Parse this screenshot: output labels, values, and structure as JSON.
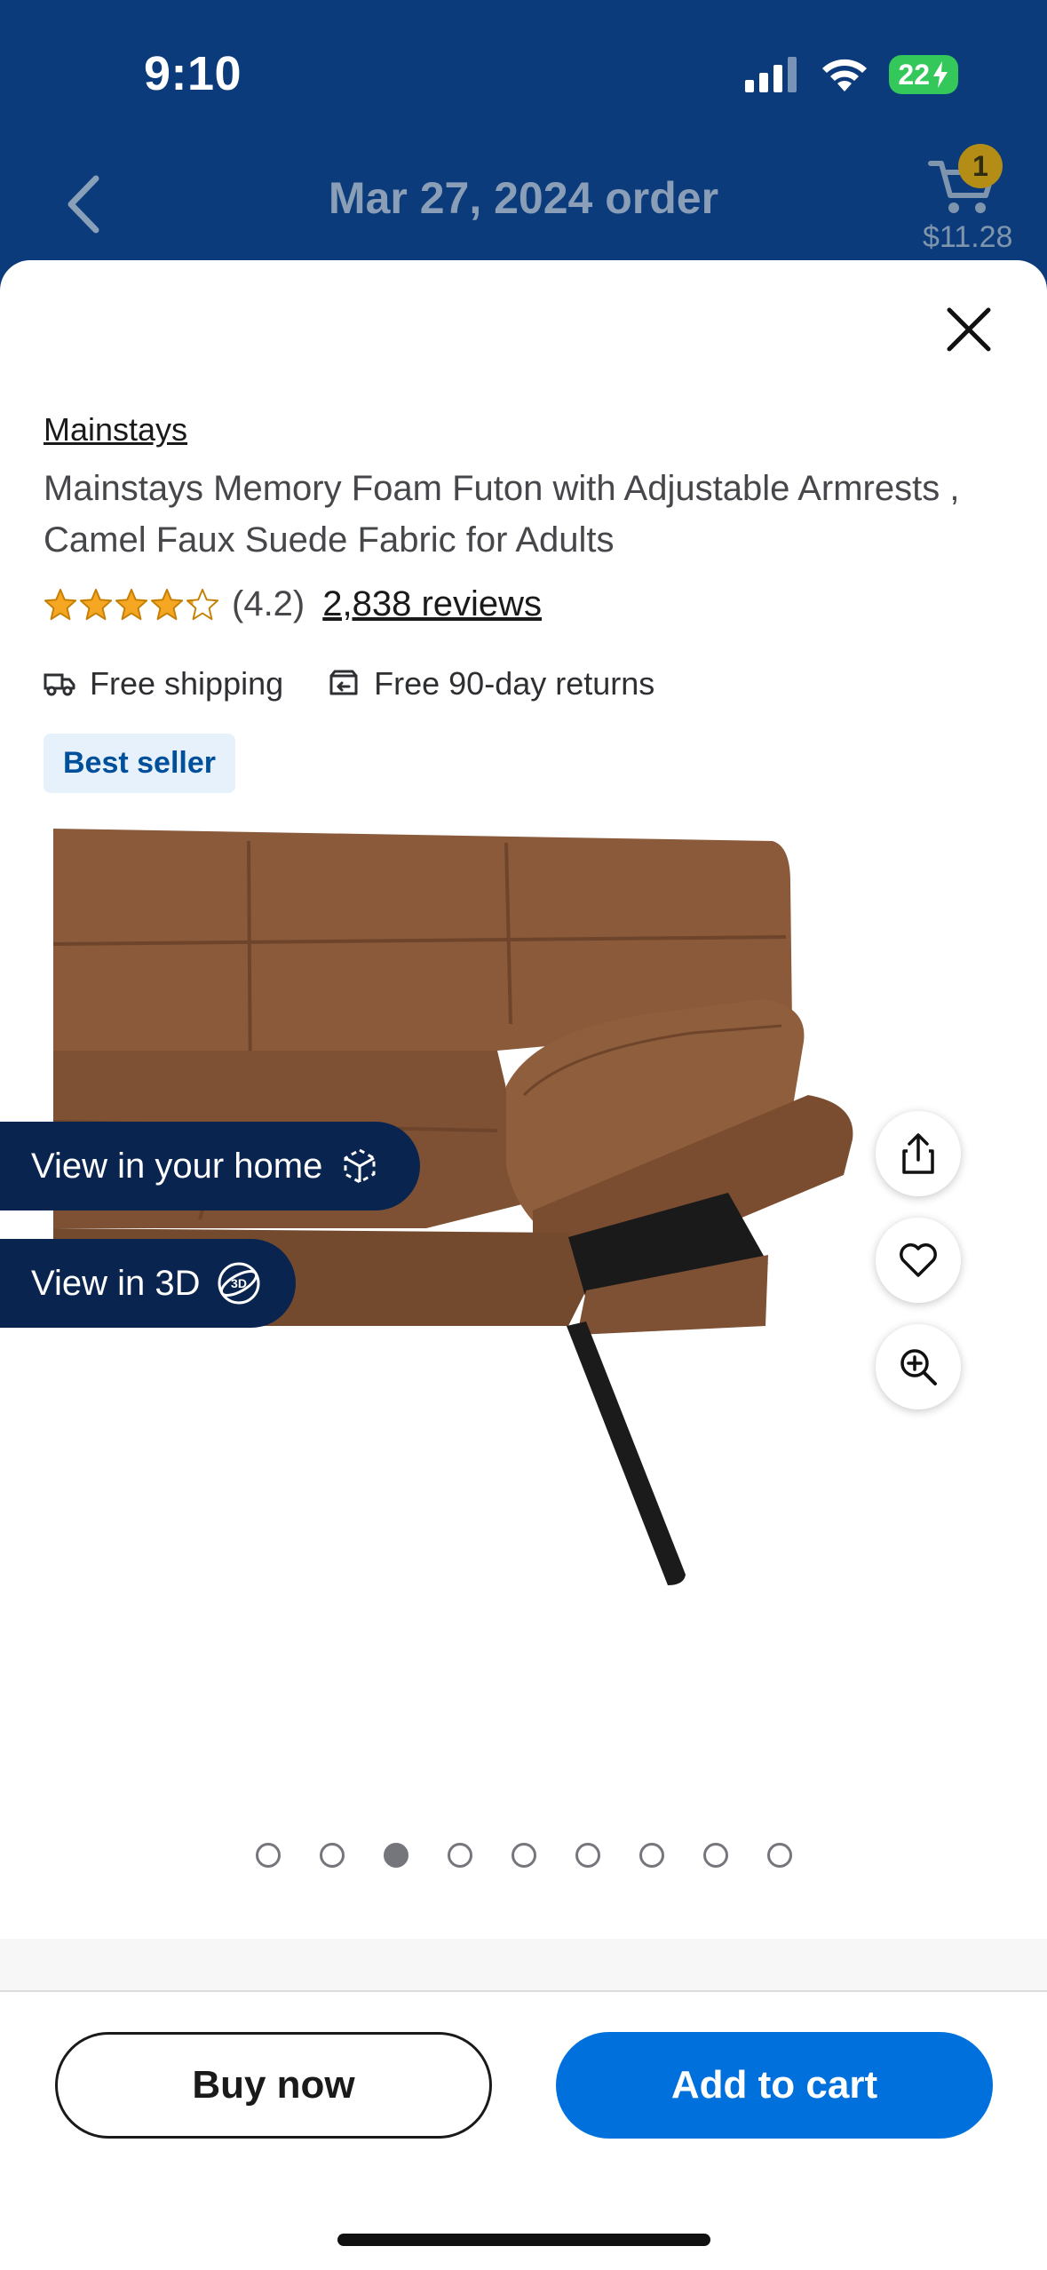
{
  "status_bar": {
    "time": "9:10",
    "battery": "22"
  },
  "nav": {
    "title": "Mar 27, 2024 order",
    "cart_count": "1",
    "cart_amount": "$11.28"
  },
  "product": {
    "brand": "Mainstays",
    "title": "Mainstays Memory Foam Futon with Adjustable Armrests , Camel Faux Suede Fabric for Adults",
    "rating": 4.2,
    "rating_text": "(4.2)",
    "reviews": "2,838 reviews",
    "shipping": "Free shipping",
    "returns": "Free 90-day returns",
    "badge": "Best seller"
  },
  "media": {
    "view_home_label": "View in your home",
    "view_3d_label": "View in 3D",
    "slide_count": 9,
    "active_slide": 3
  },
  "actions": {
    "buy_now": "Buy now",
    "add_to_cart": "Add to cart"
  },
  "colors": {
    "primary": "#0071dc",
    "header_bg": "#0b3b7a",
    "star": "#f5a623",
    "badge_text": "#004f9a"
  }
}
